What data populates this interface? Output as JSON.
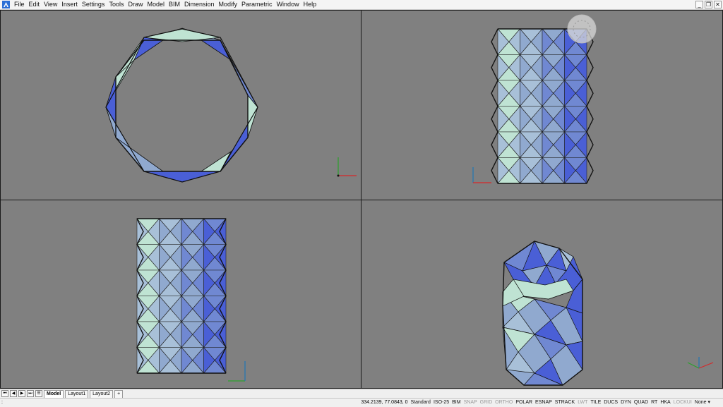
{
  "menu": [
    "File",
    "Edit",
    "View",
    "Insert",
    "Settings",
    "Tools",
    "Draw",
    "Model",
    "BIM",
    "Dimension",
    "Modify",
    "Parametric",
    "Window",
    "Help"
  ],
  "window_controls": [
    "_",
    "̅☐",
    "✕"
  ],
  "layout_tabs": {
    "nav": [
      "⏮",
      "◀",
      "▶",
      "⏭"
    ],
    "tabs": [
      "Model",
      "Layout1",
      "Layout2"
    ],
    "add": "+"
  },
  "status": {
    "prompt": ":",
    "coords": "334.2139, 77.0843, 0",
    "items": [
      {
        "label": "Standard",
        "on": true
      },
      {
        "label": "ISO-25",
        "on": true
      },
      {
        "label": "BIM",
        "on": true
      },
      {
        "label": "SNAP",
        "on": false
      },
      {
        "label": "GRID",
        "on": false
      },
      {
        "label": "ORTHO",
        "on": false
      },
      {
        "label": "POLAR",
        "on": true
      },
      {
        "label": "ESNAP",
        "on": true
      },
      {
        "label": "STRACK",
        "on": true
      },
      {
        "label": "LWT",
        "on": false
      },
      {
        "label": "TILE",
        "on": true
      },
      {
        "label": "DUCS",
        "on": true
      },
      {
        "label": "DYN",
        "on": true
      },
      {
        "label": "QUAD",
        "on": true
      },
      {
        "label": "RT",
        "on": true
      },
      {
        "label": "HKA",
        "on": true
      },
      {
        "label": "LOCKUI",
        "on": false
      },
      {
        "label": "None ▾",
        "on": true
      }
    ]
  },
  "colors": {
    "light": "#bfe3d3",
    "mid": "#90a9cf",
    "dark": "#4a5fd6",
    "medium": "#7088d2",
    "pale": "#a8c0d8"
  },
  "viewports": [
    "top-view",
    "front-view",
    "left-view",
    "iso-view"
  ]
}
